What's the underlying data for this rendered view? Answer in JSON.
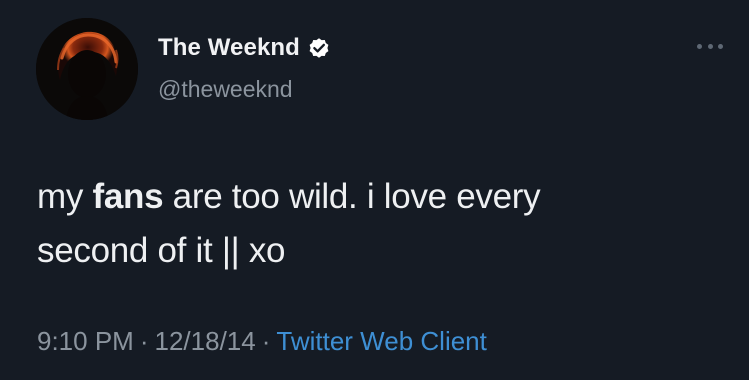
{
  "user": {
    "display_name": "The Weeknd",
    "handle": "@theweeknd",
    "verified": true
  },
  "tweet": {
    "text_before": "my ",
    "text_bold": "fans",
    "text_line1_after": " are too wild. i love every",
    "text_line2": "second of it || xo"
  },
  "meta": {
    "time": "9:10 PM",
    "separator": "·",
    "date": "12/18/14",
    "client": "Twitter Web Client"
  },
  "icons": {
    "verified": "verified-badge-icon",
    "more": "more-options-icon"
  },
  "colors": {
    "background": "#151b24",
    "verified_badge": "#ffffff",
    "client_link": "#3e8fd4",
    "secondary_text": "#8b949e"
  }
}
